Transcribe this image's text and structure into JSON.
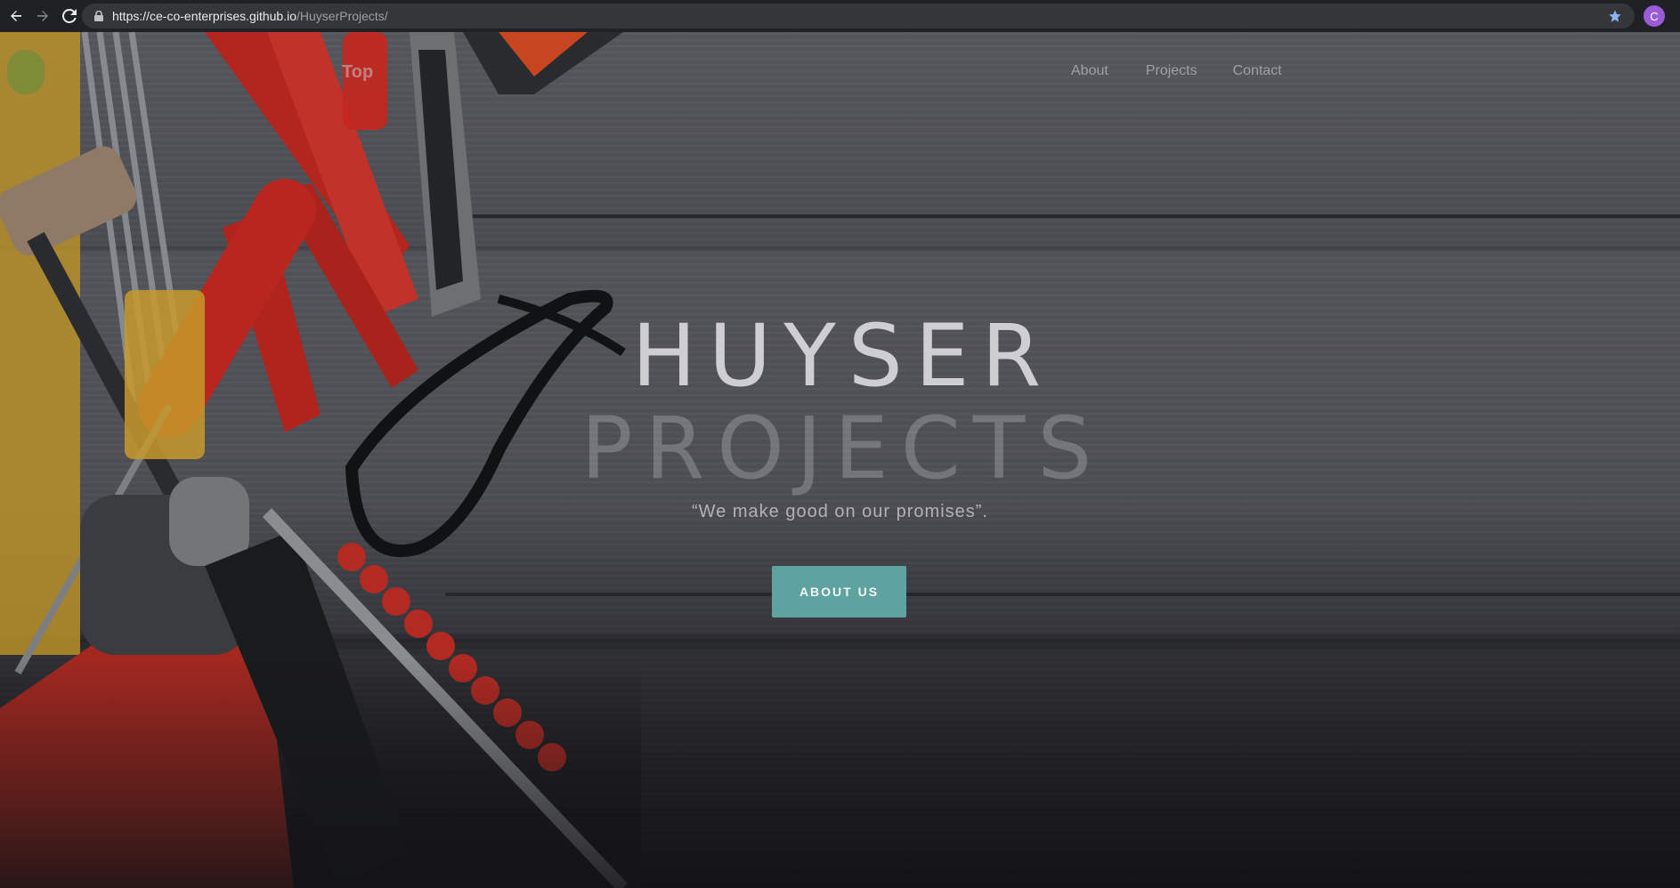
{
  "browser": {
    "url_host": "https://ce-co-enterprises.github.io",
    "url_path": "/HuyserProjects/",
    "profile_initial": "C"
  },
  "nav": {
    "brand": "Top",
    "links": [
      "About",
      "Projects",
      "Contact"
    ]
  },
  "hero": {
    "title_line1": "HUYSER",
    "title_line2": "PROJECTS",
    "tagline": "“We make good on our promises”.",
    "cta_label": "ABOUT US"
  },
  "colors": {
    "accent": "#5fa3a0",
    "chrome_bg": "#202124",
    "omnibox_bg": "#35363a"
  },
  "icons": [
    "back-arrow-icon",
    "forward-arrow-icon",
    "reload-icon",
    "lock-icon",
    "star-icon"
  ]
}
